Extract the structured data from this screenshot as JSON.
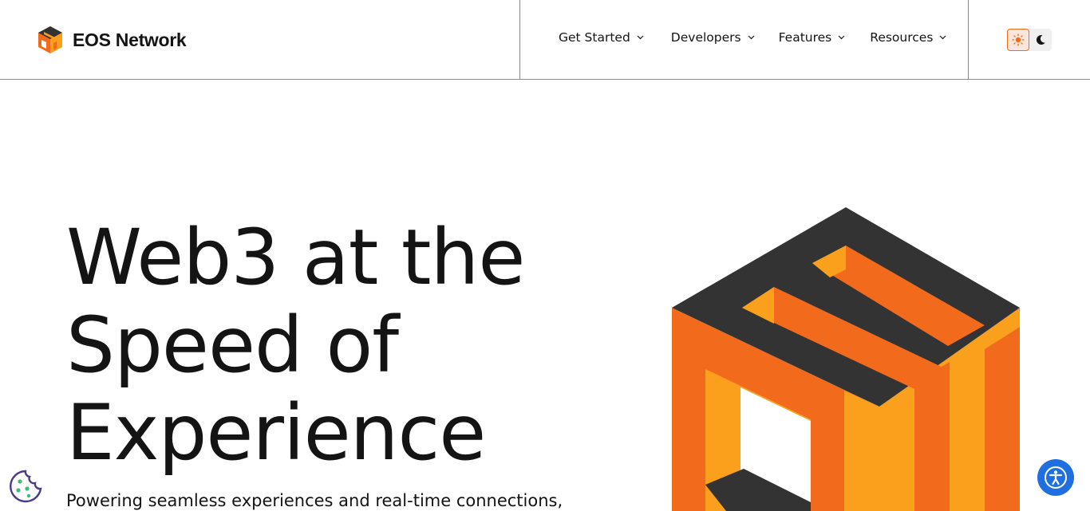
{
  "header": {
    "brand": "EOS Network",
    "nav": [
      {
        "label": "Get Started"
      },
      {
        "label": "Developers"
      },
      {
        "label": "Features"
      },
      {
        "label": "Resources"
      }
    ]
  },
  "hero": {
    "title_lines": [
      "Web3 at the",
      "Speed of",
      "Experience"
    ],
    "subtitle": "Powering seamless experiences and real-time connections,"
  },
  "theme": {
    "selected": "light"
  },
  "colors": {
    "orange_dark": "#f26b1d",
    "orange_light": "#fba01c",
    "charcoal": "#333333",
    "accessibility_blue": "#1f6fe0"
  },
  "icons": [
    "eos-logo-icon",
    "chevron-down-icon",
    "sun-icon",
    "moon-icon",
    "cookie-icon",
    "accessibility-icon"
  ]
}
